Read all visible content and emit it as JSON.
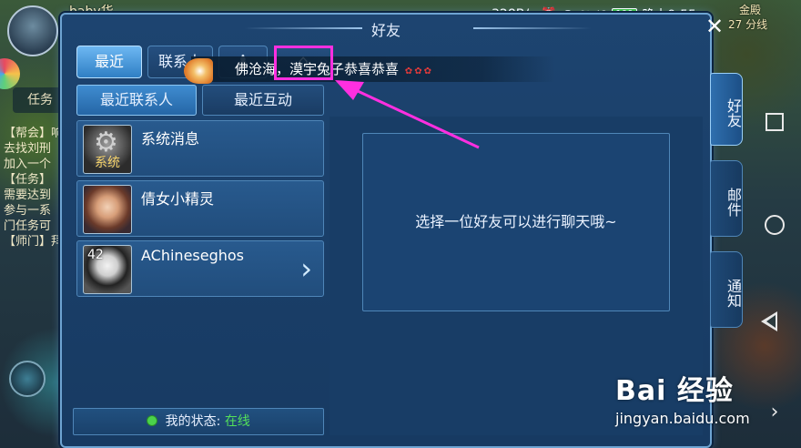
{
  "window": {
    "title": "好友"
  },
  "top_tabs": [
    {
      "label": "最近",
      "active": true
    },
    {
      "label": "联系人",
      "active": false
    },
    {
      "label": "",
      "icon": "person-icon",
      "active": false
    },
    {
      "label": "",
      "icon": "house-icon",
      "active": false
    }
  ],
  "marquee": {
    "text": "佛沧海，漠宇兔子恭喜恭喜"
  },
  "sub_tabs": [
    {
      "label": "最近联系人",
      "active": true
    },
    {
      "label": "最近互动",
      "active": false
    }
  ],
  "contacts": [
    {
      "name": "系统消息",
      "avatar_label": "系统",
      "level": ""
    },
    {
      "name": "倩女小精灵",
      "avatar_label": "",
      "level": ""
    },
    {
      "name": "AChineseghos",
      "avatar_label": "",
      "level": "42"
    }
  ],
  "my_status": {
    "label": "我的状态:",
    "value": "在线"
  },
  "chat": {
    "placeholder": "选择一位好友可以进行聊天哦~"
  },
  "side_tabs": [
    {
      "label": "好友",
      "active": true
    },
    {
      "label": "邮件",
      "active": false
    },
    {
      "label": "通知",
      "active": false
    }
  ],
  "status_bar": {
    "speed": "328B/s",
    "signal": "4G",
    "battery": "100",
    "time": "晚上9:55"
  },
  "background": {
    "task_label": "任务",
    "player_name": "baby华",
    "log_lines": [
      "【帮会】响",
      "去找刘刑",
      "加入一个",
      "【任务】",
      "需要达到",
      "参与一系",
      "门任务可",
      "【师门】拜"
    ],
    "other_text": "金殿",
    "other_sub": "27 分线"
  },
  "watermark": {
    "brand": "Bai 经验",
    "url": "jingyan.baidu.com"
  },
  "colors": {
    "accent": "#6db7f2",
    "panel": "#1d4470",
    "highlight": "#ff2fe0",
    "online": "#54e05a"
  }
}
